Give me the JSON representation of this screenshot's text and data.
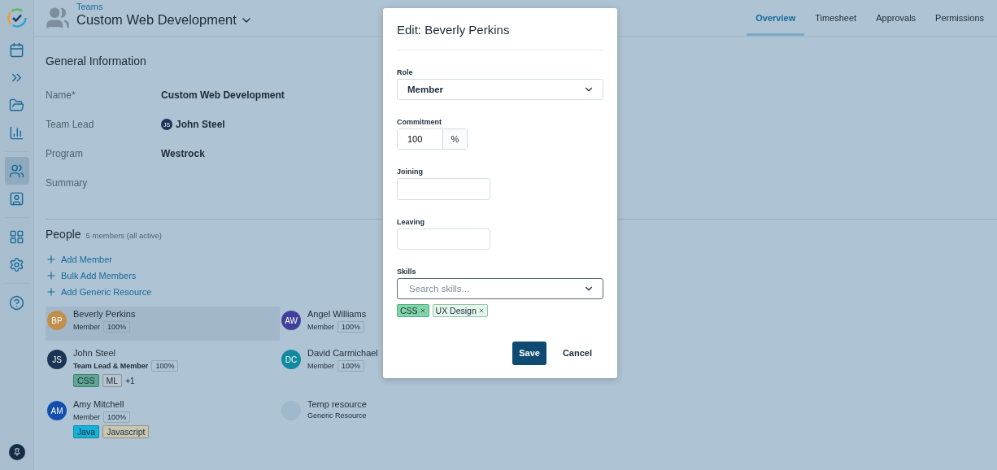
{
  "sidebar": {
    "items": [
      {
        "selected": false
      },
      {
        "selected": false
      },
      {
        "selected": false
      },
      {
        "selected": false
      },
      {
        "selected": true
      },
      {
        "selected": false
      },
      {
        "selected": false
      },
      {
        "selected": false
      },
      {
        "selected": false
      },
      {
        "selected": false
      }
    ]
  },
  "header": {
    "breadcrumb": "Teams",
    "title": "Custom Web Development"
  },
  "tabs": [
    {
      "label": "Overview",
      "selected": true
    },
    {
      "label": "Timesheet",
      "selected": false
    },
    {
      "label": "Approvals",
      "selected": false
    },
    {
      "label": "Permissions",
      "selected": false
    }
  ],
  "general": {
    "title": "General Information",
    "fields": [
      {
        "kind": "text",
        "label": "Name*",
        "value": "Custom Web Development"
      },
      {
        "kind": "person",
        "label": "Team Lead",
        "initials": "JS",
        "value": "John Steel"
      },
      {
        "kind": "text",
        "label": "Program",
        "value": "Westrock"
      },
      {
        "kind": "text",
        "label": "Summary"
      }
    ]
  },
  "people": {
    "title": "People",
    "count": "5 members (all active)",
    "actions": [
      "Add Member",
      "Bulk Add Members",
      "Add Generic Resource"
    ],
    "members": [
      {
        "kind": "member",
        "initials": "BP",
        "color": "#c08f4c",
        "name": "Beverly Perkins",
        "role": "Member",
        "lead": false,
        "commitment": "100%",
        "selected": true
      },
      {
        "kind": "member",
        "initials": "AW",
        "color": "#40419a",
        "name": "Angel Williams",
        "role": "Member",
        "lead": false,
        "commitment": "100%",
        "selected": false
      },
      {
        "kind": "member",
        "initials": "JS",
        "color": "#1c3456",
        "name": "John Steel",
        "role": "Team Lead & Member",
        "lead": true,
        "commitment": "100%",
        "selected": false,
        "tags": [
          {
            "label": "CSS",
            "color": "#5ea792"
          },
          {
            "label": "ML",
            "color": "#b7c4cd"
          }
        ],
        "more": "+1"
      },
      {
        "kind": "member",
        "initials": "DC",
        "color": "#11899f",
        "name": "David Carmichael",
        "role": "Member",
        "lead": false,
        "commitment": "100%",
        "selected": false
      },
      {
        "kind": "member",
        "initials": "AM",
        "color": "#1350ae",
        "name": "Amy Mitchell",
        "role": "Member",
        "lead": false,
        "commitment": "100%",
        "selected": false,
        "tags": [
          {
            "label": "Java",
            "color": "#14b1d9"
          },
          {
            "label": "Javascript",
            "color": "#c8c6b0"
          }
        ]
      },
      {
        "kind": "generic",
        "color": "#9fb8cb",
        "name": "Temp resource",
        "role": "Generic Resource",
        "selected": false
      }
    ]
  },
  "modal": {
    "title": "Edit: Beverly Perkins",
    "role": {
      "label": "Role",
      "value": "Member"
    },
    "commitment": {
      "label": "Commitment",
      "value": "100",
      "unit": "%"
    },
    "joining": {
      "label": "Joining"
    },
    "leaving": {
      "label": "Leaving"
    },
    "skills": {
      "label": "Skills",
      "placeholder": "Search skills...",
      "tags": [
        {
          "label": "CSS",
          "color": "#82d4a9"
        },
        {
          "label": "UX Design",
          "color": "#e4f5ea"
        }
      ]
    },
    "buttons": {
      "save": "Save",
      "cancel": "Cancel"
    }
  }
}
